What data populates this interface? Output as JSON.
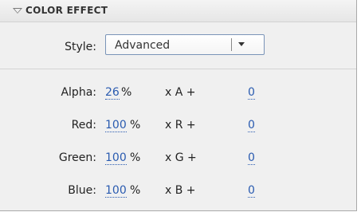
{
  "panel": {
    "title": "COLOR EFFECT",
    "style": {
      "label": "Style:",
      "value": "Advanced"
    },
    "rows": [
      {
        "label": "Alpha:",
        "percent": "26",
        "percent_sign": "%",
        "multiplier": "x A  +",
        "offset": "0"
      },
      {
        "label": "Red:",
        "percent": "100",
        "percent_sign": "%",
        "multiplier": "x R  +",
        "offset": "0"
      },
      {
        "label": "Green:",
        "percent": "100",
        "percent_sign": "%",
        "multiplier": "x G  +",
        "offset": "0"
      },
      {
        "label": "Blue:",
        "percent": "100",
        "percent_sign": "%",
        "multiplier": "x B  +",
        "offset": "0"
      }
    ]
  },
  "colors": {
    "link": "#2a5bb0",
    "panel_bg": "#f0f0f0",
    "header_bg": "#e6e6e6"
  }
}
